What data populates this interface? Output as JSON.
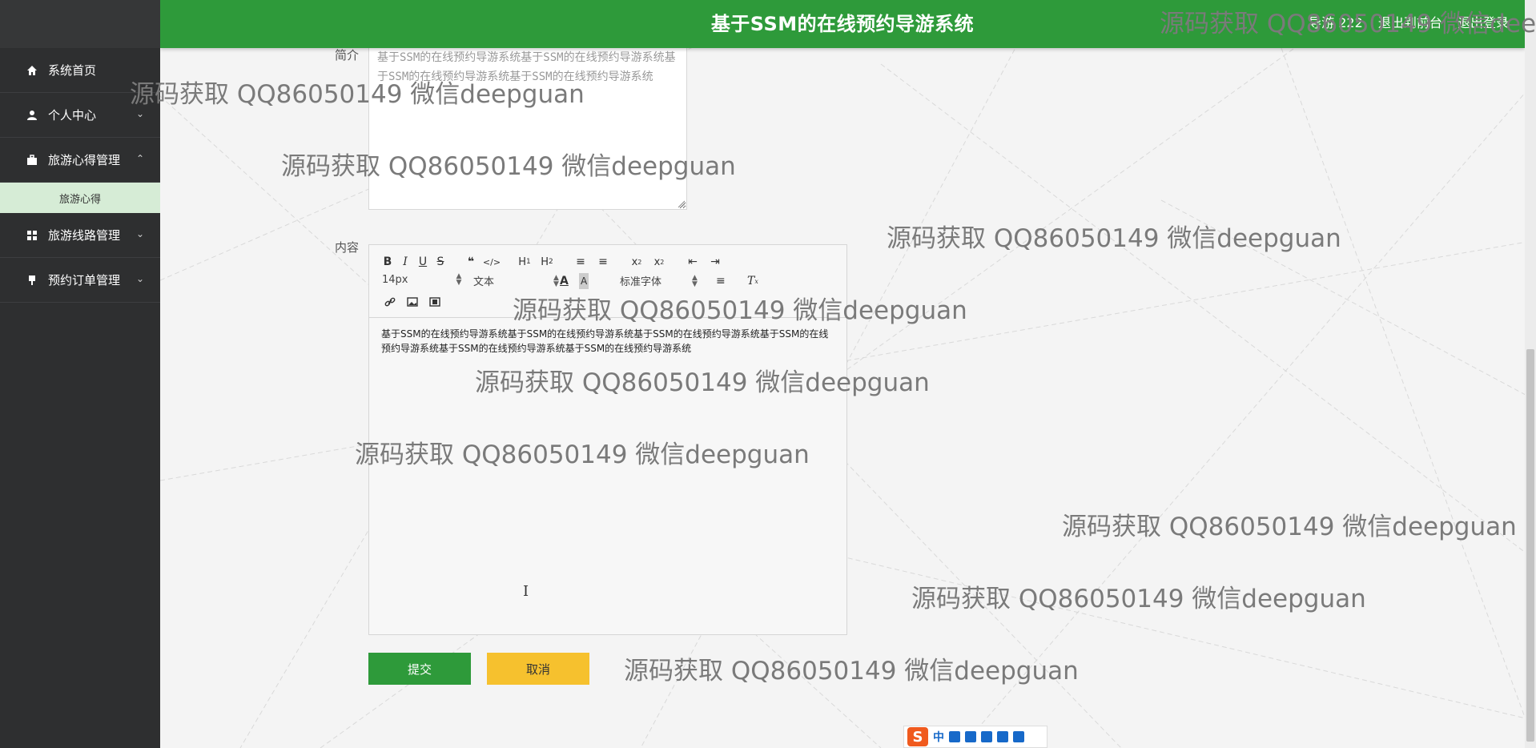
{
  "app": {
    "title": "基于SSM的在线预约导游系统"
  },
  "header": {
    "user_text": "导游 222",
    "back_link": "退出到前台",
    "logout_link": "退出登录"
  },
  "sidebar": {
    "items": [
      {
        "label": "系统首页",
        "icon": "home-icon"
      },
      {
        "label": "个人中心",
        "icon": "user-icon"
      },
      {
        "label": "旅游心得管理",
        "icon": "briefcase-icon"
      },
      {
        "label": "旅游线路管理",
        "icon": "grid-icon"
      },
      {
        "label": "预约订单管理",
        "icon": "pin-icon"
      }
    ],
    "sub_items": [
      {
        "label": "旅游心得"
      }
    ]
  },
  "form": {
    "intro_label": "简介",
    "intro_value": "基于SSM的在线预约导游系统基于SSM的在线预约导游系统基于SSM的在线预约导游系统基于SSM的在线预约导游系统",
    "content_label": "内容",
    "editor": {
      "font_size": "14px",
      "paragraph": "文本",
      "font_family": "标准字体",
      "content": "基于SSM的在线预约导游系统基于SSM的在线预约导游系统基于SSM的在线预约导游系统基于SSM的在线预约导游系统基于SSM的在线预约导游系统基于SSM的在线预约导游系统"
    },
    "submit_label": "提交",
    "cancel_label": "取消"
  },
  "watermark": {
    "text": "源码获取 QQ86050149 微信deepguan"
  },
  "ime": {
    "lang": "中",
    "logo": "S"
  },
  "colors": {
    "header": "#2e9a3a",
    "sidebar": "#2e2f30",
    "sub_item_bg": "#d6ecd6",
    "cancel": "#f6c12e"
  }
}
